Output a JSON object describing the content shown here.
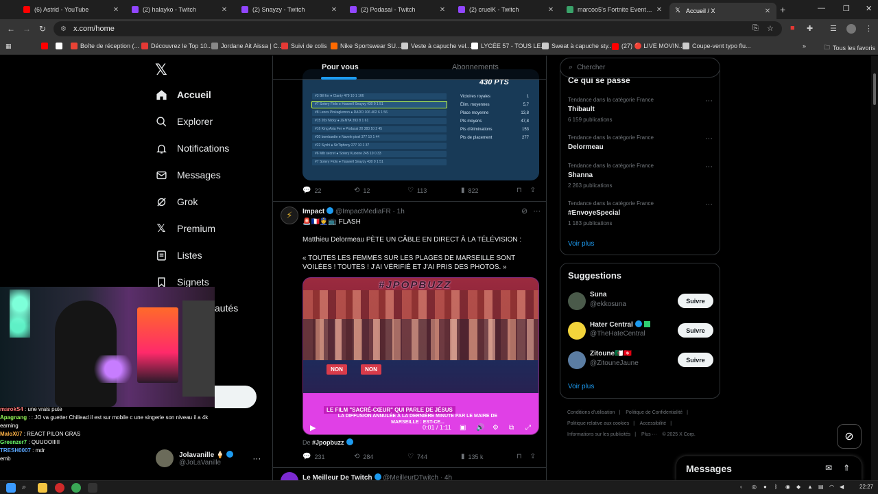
{
  "browser": {
    "tabs": [
      {
        "title": "(6) Astrid - YouTube",
        "color": "#ff0000"
      },
      {
        "title": "(2) halayko - Twitch",
        "color": "#9146ff"
      },
      {
        "title": "(2) Snayzy - Twitch",
        "color": "#9146ff"
      },
      {
        "title": "(2) Podasai - Twitch",
        "color": "#9146ff"
      },
      {
        "title": "(2) cruelK - Twitch",
        "color": "#9146ff"
      },
      {
        "title": "marcoo5's Fortnite Events - Fo",
        "color": "#3aa36a"
      },
      {
        "title": "Accueil / X",
        "color": "#ffffff"
      }
    ],
    "url": "x.com/home",
    "bookmarks": [
      {
        "label": "",
        "color": "#ff0000"
      },
      {
        "label": "",
        "color": "#ffffff"
      },
      {
        "label": "Boîte de réception (...",
        "color": "#ea4335"
      },
      {
        "label": "Découvrez le Top 10...",
        "color": "#e53935"
      },
      {
        "label": "Jordane Ait Aissa | C...",
        "color": "#888888"
      },
      {
        "label": "Suivi de colis",
        "color": "#e53935"
      },
      {
        "label": "Nike Sportswear SU...",
        "color": "#ff6a00"
      },
      {
        "label": "Veste à capuche vel...",
        "color": "#cccccc"
      },
      {
        "label": "LYCÉE 57 - TOUS LE...",
        "color": "#ffffff"
      },
      {
        "label": "Sweat à capuche sty...",
        "color": "#cccccc"
      },
      {
        "label": "(27) 🔴 LIVE MOVIN...",
        "color": "#ff0000"
      },
      {
        "label": "Coupe-vent typo flu...",
        "color": "#cccccc"
      }
    ],
    "all_bookmarks": "Tous les favoris"
  },
  "nav": {
    "items": [
      {
        "label": "Accueil"
      },
      {
        "label": "Explorer"
      },
      {
        "label": "Notifications"
      },
      {
        "label": "Messages"
      },
      {
        "label": "Grok"
      },
      {
        "label": "Premium"
      },
      {
        "label": "Listes"
      },
      {
        "label": "Signets"
      },
      {
        "label": "autés"
      }
    ],
    "profile": {
      "name": "Jolavanille 🍦",
      "handle": "@JoLaVanille"
    }
  },
  "timeline": {
    "tabs": [
      "Pour vous",
      "Abonnements"
    ],
    "post1": {
      "image": {
        "points": "430 PTS",
        "rows": [
          "#3  Bill for ● Clanty  479  10  1  166",
          "#7  Sotery Flolo ● Haswell Snayzy  430  9  1  51",
          "#8  Lenox Pinkaglemon ● DADO 106  402  6  1  56",
          "#15  20x Nicky ● ZENYA  393  8  1  61",
          "#16  King Asia Fer ● Podasai 20  383  10  2  45",
          "#20  bombardie ● Navele pixel  377  10  1  44",
          "#22  Sychi ● SirTiphony  277  10  1  37",
          "#6  Mib secret ● Sotery Kuoone  245  10  0  33",
          "#7  Sotery Flolo ● Haswell Snayzy  430  9  1  51"
        ],
        "stats": [
          [
            "Victoires royales",
            "1"
          ],
          [
            "Élim. moyennes",
            "5,7"
          ],
          [
            "Place moyenne",
            "13,8"
          ],
          [
            "Pts moyens",
            "47,8"
          ],
          [
            "Pts d'éliminations",
            "153"
          ],
          [
            "Pts de placement",
            "277"
          ]
        ]
      },
      "replies": "22",
      "reposts": "12",
      "likes": "113",
      "views": "822"
    },
    "post2": {
      "name": "Impact",
      "handle": "@ImpactMediaFR",
      "time": "· 1h",
      "flash": "🚨🇫🇷👮📺 FLASH",
      "text": "Matthieu Delormeau PÈTE UN CÂBLE EN DIRECT À LA TÉLÉVISION :",
      "quote": "« TOUTES LES FEMMES SUR LES PLAGES DE MARSEILLE SONT VOILÉES ! TOUTES ! J'AI VÉRIFIÉ ET J'AI PRIS DES PHOTOS. »",
      "video": {
        "watermark": "#JPOPBUZZ",
        "non": "NON",
        "banner1": "LE FILM \"SACRÉ-CŒUR\" QUI PARLE DE JÉSUS",
        "banner2": "LA DIFFUSION ANNULÉE À LA DERNIÈRE MINUTE PAR LE MAIRE DE MARSEILLE : EST-CE...",
        "time": "0:01 / 1:11"
      },
      "from_prefix": "De",
      "from": "#Jpopbuzz",
      "replies": "231",
      "reposts": "284",
      "likes": "744",
      "views": "135 k"
    },
    "post3": {
      "name": "Le Meilleur De Twitch",
      "handle": "@MeilleurDTwitch",
      "time": "· 4h"
    }
  },
  "right": {
    "search_placeholder": "Chercher",
    "trends_title": "Ce qui se passe",
    "trends": [
      {
        "category": "Tendance dans la catégorie France",
        "name": "Thibault",
        "count": "6 159 publications"
      },
      {
        "category": "Tendance dans la catégorie France",
        "name": "Delormeau",
        "count": ""
      },
      {
        "category": "Tendance dans la catégorie France",
        "name": "Shanna",
        "count": "2 263 publications"
      },
      {
        "category": "Tendance dans la catégorie France",
        "name": "#EnvoyeSpecial",
        "count": "1 183 publications"
      }
    ],
    "see_more": "Voir plus",
    "suggestions_title": "Suggestions",
    "suggestions": [
      {
        "name": "Suna",
        "handle": "@ekkosuna",
        "color": "#4a5a4a"
      },
      {
        "name": "Hater Central",
        "handle": "@TheHateCentral",
        "color": "#f2d43b"
      },
      {
        "name": "Zitoune🇩🇿🇹🇳",
        "handle": "@ZitouneJaune",
        "color": "#5b7da3"
      }
    ],
    "follow_label": "Suivre",
    "footer": [
      "Conditions d'utilisation",
      "|",
      "Politique de Confidentialité",
      "|",
      "Politique relative aux cookies",
      "|",
      "Accessibilité",
      "|",
      "Informations sur les publicités",
      "|",
      "Plus ···",
      "© 2025 X Corp."
    ],
    "messages_label": "Messages"
  },
  "overlay": {
    "chat": [
      {
        "user": "marokS4",
        "msg": ": une vrais pute",
        "color": "#ff7a7a"
      },
      {
        "user": "Apagnang",
        "msg": ": : JO va guetter Chillead il est sur mobile c une singerie son niveau il a 4k earning",
        "color": "#9aff5a"
      },
      {
        "user": "MaloX07",
        "msg": ": REACT PILON GRAS",
        "color": "#ffb347"
      },
      {
        "user": "Greenzer7",
        "msg": ": QUUOOIIIII",
        "color": "#6bff6b"
      },
      {
        "user": "TRESH0007",
        "msg": ": mdr",
        "color": "#5aa7ff"
      },
      {
        "user": "",
        "msg": "emb",
        "color": "#ffffff"
      }
    ]
  },
  "taskbar": {
    "clock": "22:27"
  }
}
